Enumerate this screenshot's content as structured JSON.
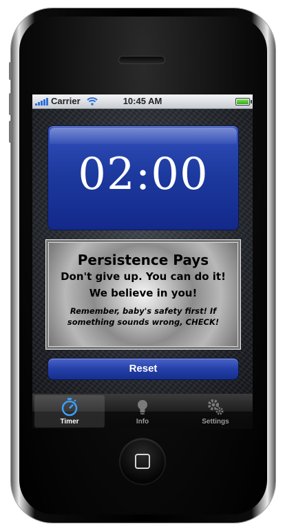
{
  "statusbar": {
    "carrier": "Carrier",
    "time": "10:45 AM",
    "battery_level": 1.0
  },
  "timer": {
    "display": "02:00"
  },
  "message": {
    "title": "Persistence Pays",
    "line1": "Don't give up. You can do it!",
    "line2": "We believe in you!",
    "note": "Remember, baby's safety first! If something sounds wrong, CHECK!"
  },
  "reset_button": {
    "label": "Reset"
  },
  "tabs": [
    {
      "label": "Timer",
      "icon": "stopwatch-icon",
      "selected": true
    },
    {
      "label": "Info",
      "icon": "lightbulb-icon",
      "selected": false
    },
    {
      "label": "Settings",
      "icon": "gears-icon",
      "selected": false
    }
  ],
  "colors": {
    "panel_blue": "#1d3a9f",
    "tab_selected_icon": "#3aa0ff"
  }
}
